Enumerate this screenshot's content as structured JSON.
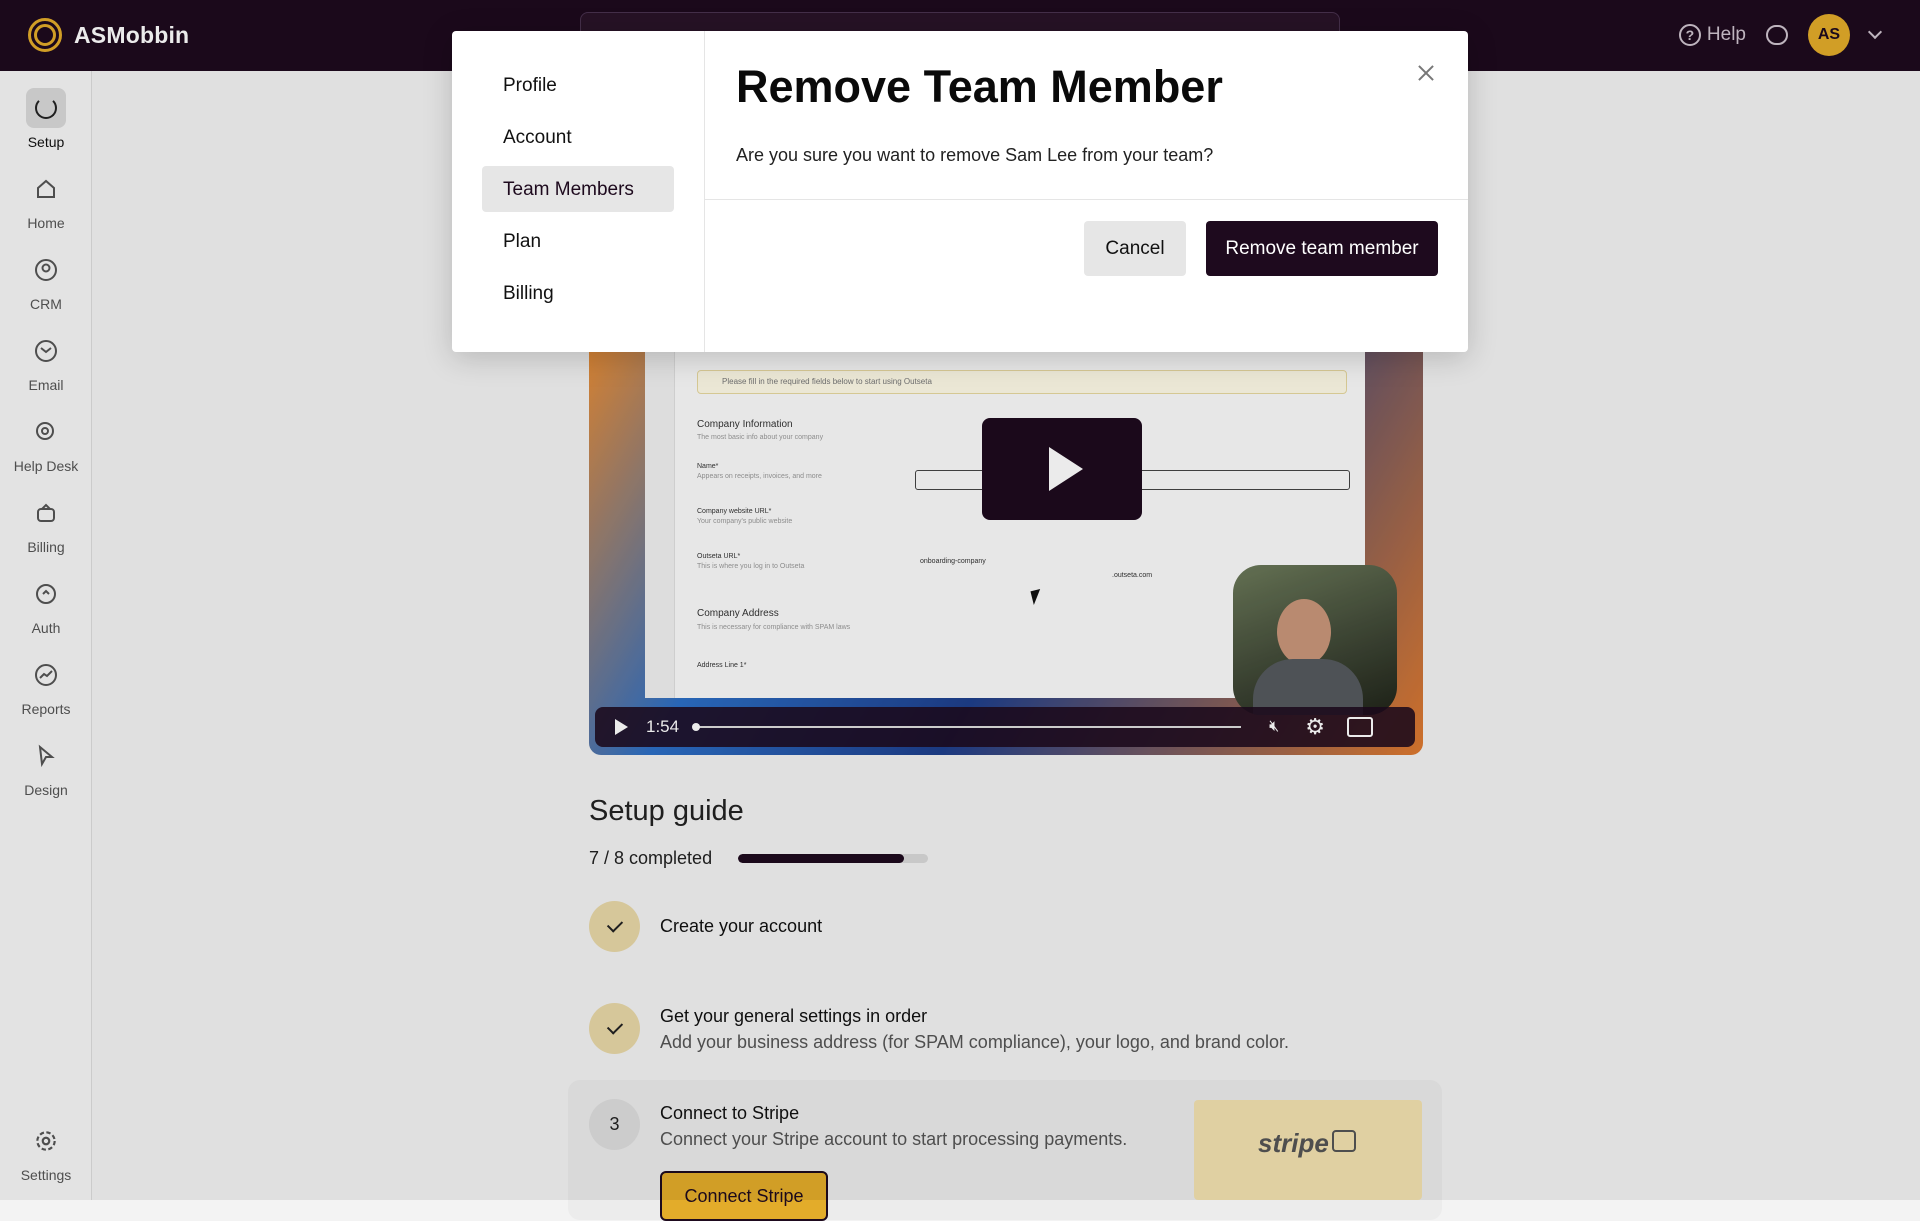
{
  "app": {
    "name": "ASMobbin"
  },
  "topbar": {
    "help_label": "Help",
    "avatar_initials": "AS"
  },
  "sidebar": {
    "items": [
      {
        "label": "Setup",
        "icon": "setup-icon"
      },
      {
        "label": "Home",
        "icon": "home-icon"
      },
      {
        "label": "CRM",
        "icon": "crm-icon"
      },
      {
        "label": "Email",
        "icon": "email-icon"
      },
      {
        "label": "Help Desk",
        "icon": "help-desk-icon"
      },
      {
        "label": "Billing",
        "icon": "billing-icon"
      },
      {
        "label": "Auth",
        "icon": "auth-icon"
      },
      {
        "label": "Reports",
        "icon": "reports-icon"
      },
      {
        "label": "Design",
        "icon": "design-icon"
      },
      {
        "label": "Settings",
        "icon": "gear-icon"
      }
    ]
  },
  "video": {
    "time": "1:54",
    "screen": {
      "banner": "Please fill in the required fields below to start using Outseta",
      "company_info": "Company Information",
      "company_info_sub": "The most basic info about your company",
      "name_label": "Name*",
      "name_sub": "Appears on receipts, invoices, and more",
      "website_label": "Company website URL*",
      "website_sub": "Your company's public website",
      "outseta_label": "Outseta URL*",
      "outseta_sub": "This is where you log in to Outseta",
      "outseta_value": "onboarding-company",
      "outseta_domain": ".outseta.com",
      "address_title": "Company Address",
      "address_sub": "This is necessary for compliance with SPAM laws",
      "address_line": "Address Line 1*"
    }
  },
  "setup_guide": {
    "title": "Setup guide",
    "progress_text": "7 / 8 completed",
    "progress_fraction": 0.875,
    "steps": [
      {
        "title": "Create your account",
        "status": "done"
      },
      {
        "title": "Get your general settings in order",
        "desc": "Add your business address (for SPAM compliance), your logo, and brand color.",
        "status": "done"
      },
      {
        "number": "3",
        "title": "Connect to Stripe",
        "desc": "Connect your Stripe account to start processing payments.",
        "button": "Connect Stripe",
        "status": "pending"
      }
    ],
    "stripe_logo": "stripe"
  },
  "modal": {
    "nav": [
      "Profile",
      "Account",
      "Team Members",
      "Plan",
      "Billing"
    ],
    "active_nav": "Team Members",
    "title": "Remove Team Member",
    "body": "Are you sure you want to remove Sam Lee from your team?",
    "cancel_label": "Cancel",
    "confirm_label": "Remove team member"
  },
  "colors": {
    "brand_dark": "#1e0a1e",
    "accent": "#e3ac2a"
  }
}
